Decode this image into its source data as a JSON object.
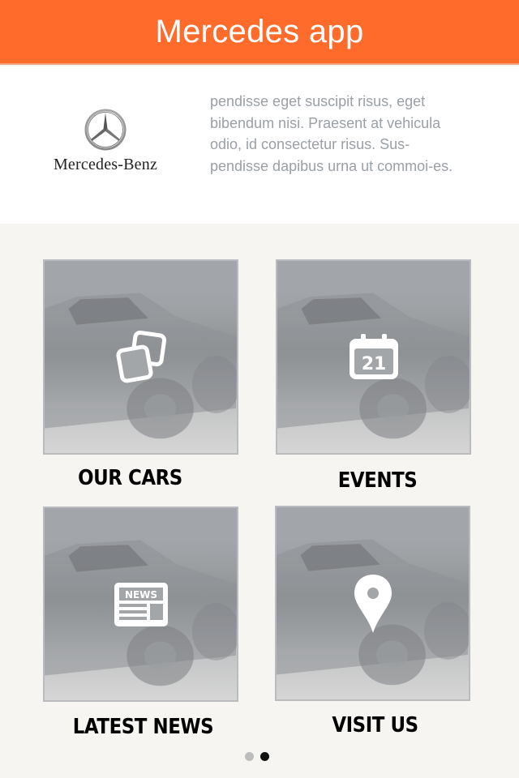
{
  "header": {
    "title": "Mercedes app"
  },
  "intro": {
    "logo_text": "Mercedes-Benz",
    "description": "pendisse eget suscipit risus, eget bibendum nisi. Praesent at vehicula odio, id consectetur risus. Sus-pendisse dapibus urna ut commoi-es."
  },
  "tiles": [
    {
      "label": "OUR CARS",
      "icon": "gallery-icon"
    },
    {
      "label": "EVENTS",
      "icon": "calendar-icon",
      "icon_text": "21"
    },
    {
      "label": "LATEST NEWS",
      "icon": "newspaper-icon",
      "icon_text": "NEWS"
    },
    {
      "label": "VISIT US",
      "icon": "map-pin-icon"
    }
  ],
  "pager": {
    "count": 2,
    "active_index": 1
  },
  "colors": {
    "accent": "#ff6b2b",
    "dot_inactive": "#bdbdbd",
    "dot_active": "#111111"
  }
}
